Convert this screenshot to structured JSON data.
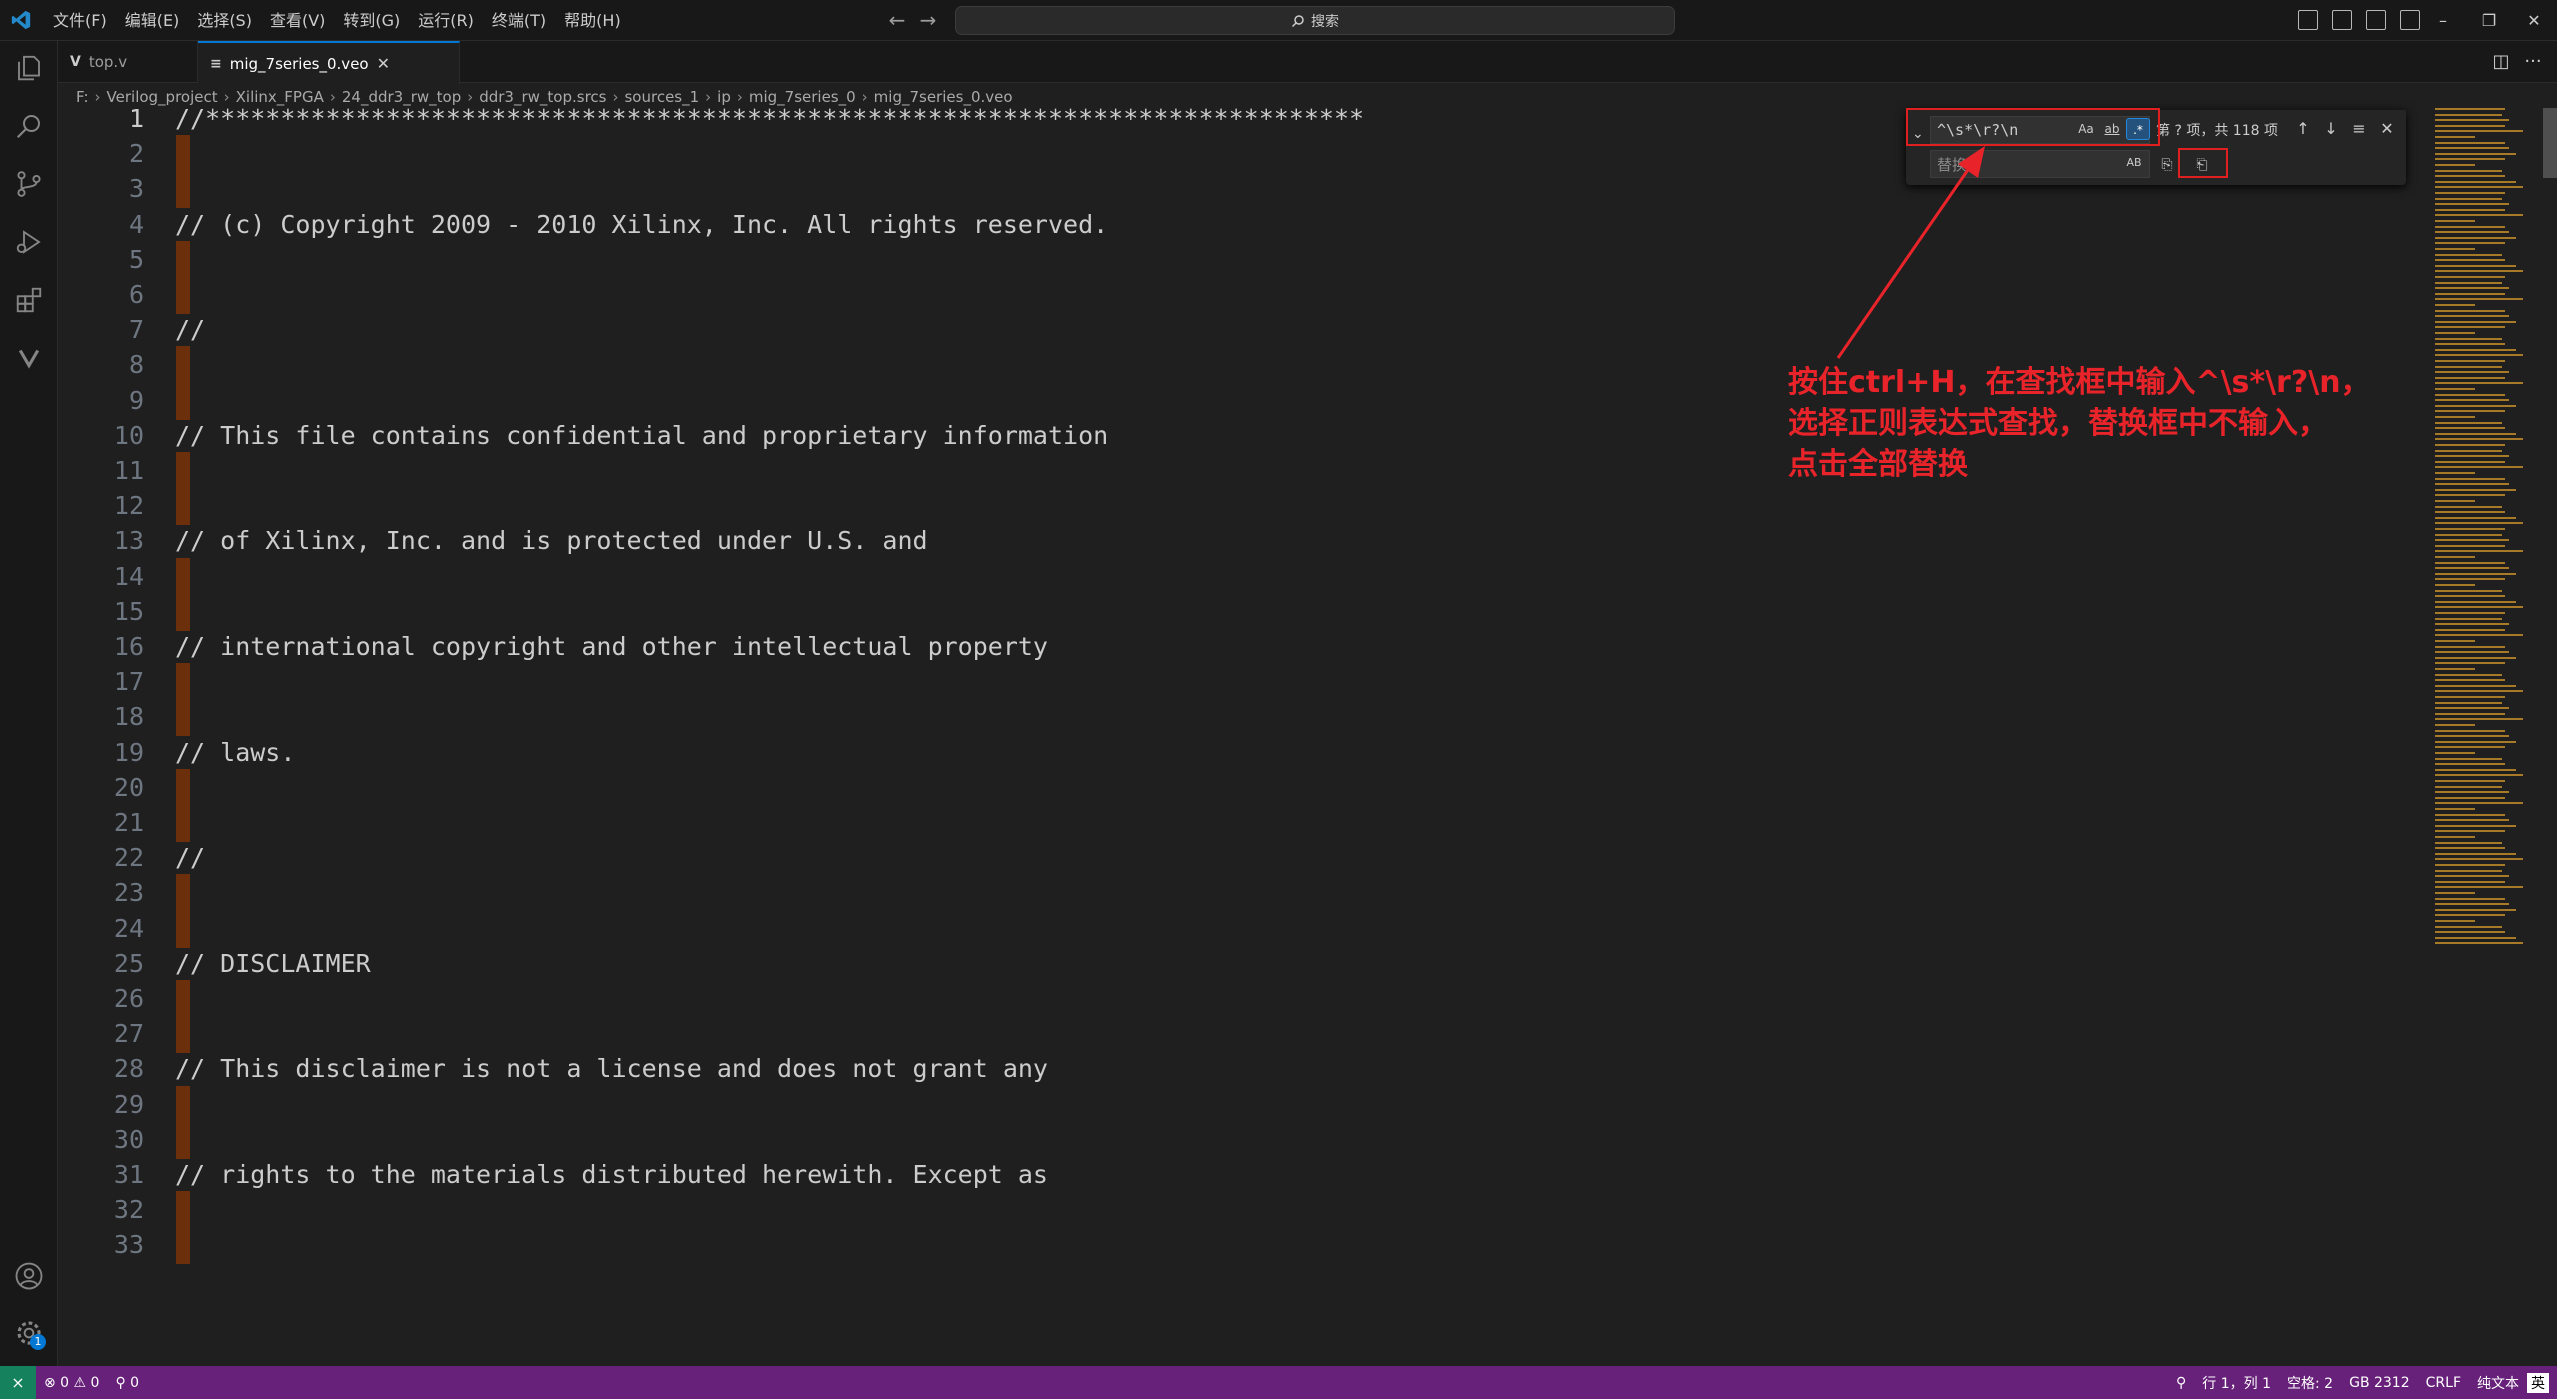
{
  "menu": [
    "文件(F)",
    "编辑(E)",
    "选择(S)",
    "查看(V)",
    "转到(G)",
    "运行(R)",
    "终端(T)",
    "帮助(H)"
  ],
  "search": {
    "label": "搜索"
  },
  "tabs": [
    {
      "icon": "V",
      "label": "top.v"
    },
    {
      "icon": "≡",
      "label": "mig_7series_0.veo"
    }
  ],
  "breadcrumb": [
    "F:",
    "Verilog_project",
    "Xilinx_FPGA",
    "24_ddr3_rw_top",
    "ddr3_rw_top.srcs",
    "sources_1",
    "ip",
    "mig_7series_0",
    "mig_7series_0.veo"
  ],
  "editor": {
    "active_line": 1,
    "lines": [
      {
        "n": "1",
        "text": "//*****************************************************************************"
      },
      {
        "n": "2",
        "text": ""
      },
      {
        "n": "3",
        "text": ""
      },
      {
        "n": "4",
        "text": "// (c) Copyright 2009 - 2010 Xilinx, Inc. All rights reserved."
      },
      {
        "n": "5",
        "text": ""
      },
      {
        "n": "6",
        "text": ""
      },
      {
        "n": "7",
        "text": "//"
      },
      {
        "n": "8",
        "text": ""
      },
      {
        "n": "9",
        "text": ""
      },
      {
        "n": "10",
        "text": "// This file contains confidential and proprietary information"
      },
      {
        "n": "11",
        "text": ""
      },
      {
        "n": "12",
        "text": ""
      },
      {
        "n": "13",
        "text": "// of Xilinx, Inc. and is protected under U.S. and"
      },
      {
        "n": "14",
        "text": ""
      },
      {
        "n": "15",
        "text": ""
      },
      {
        "n": "16",
        "text": "// international copyright and other intellectual property"
      },
      {
        "n": "17",
        "text": ""
      },
      {
        "n": "18",
        "text": ""
      },
      {
        "n": "19",
        "text": "// laws."
      },
      {
        "n": "20",
        "text": ""
      },
      {
        "n": "21",
        "text": ""
      },
      {
        "n": "22",
        "text": "//"
      },
      {
        "n": "23",
        "text": ""
      },
      {
        "n": "24",
        "text": ""
      },
      {
        "n": "25",
        "text": "// DISCLAIMER"
      },
      {
        "n": "26",
        "text": ""
      },
      {
        "n": "27",
        "text": ""
      },
      {
        "n": "28",
        "text": "// This disclaimer is not a license and does not grant any"
      },
      {
        "n": "29",
        "text": ""
      },
      {
        "n": "30",
        "text": ""
      },
      {
        "n": "31",
        "text": "// rights to the materials distributed herewith. Except as"
      },
      {
        "n": "32",
        "text": ""
      },
      {
        "n": "33",
        "text": ""
      }
    ]
  },
  "find": {
    "find_value": "^\\s*\\r?\\n",
    "match_case_label": "Aa",
    "whole_word_label": "ab",
    "regex_label": ".*",
    "count": "第 ? 项，共 118 项",
    "replace_placeholder": "替换",
    "preserve_case_label": "AB"
  },
  "annotation": {
    "lines": [
      "按住ctrl+H，在查找框中输入^\\s*\\r?\\n，",
      "选择正则表达式查找，替换框中不输入，",
      "点击全部替换"
    ],
    "color": "#e8242a"
  },
  "status": {
    "errors": "⊗ 0 ⚠ 0",
    "ports": "⚲ 0",
    "position": "行 1，列 1",
    "spaces": "空格: 2",
    "encoding": "GB 2312",
    "eol": "CRLF",
    "language": "纯文本",
    "ime": "英"
  },
  "colors": {
    "accent": "#0078d4",
    "status_bar": "#68217a",
    "remote": "#16825d",
    "highlight": "#6b2f0c"
  }
}
